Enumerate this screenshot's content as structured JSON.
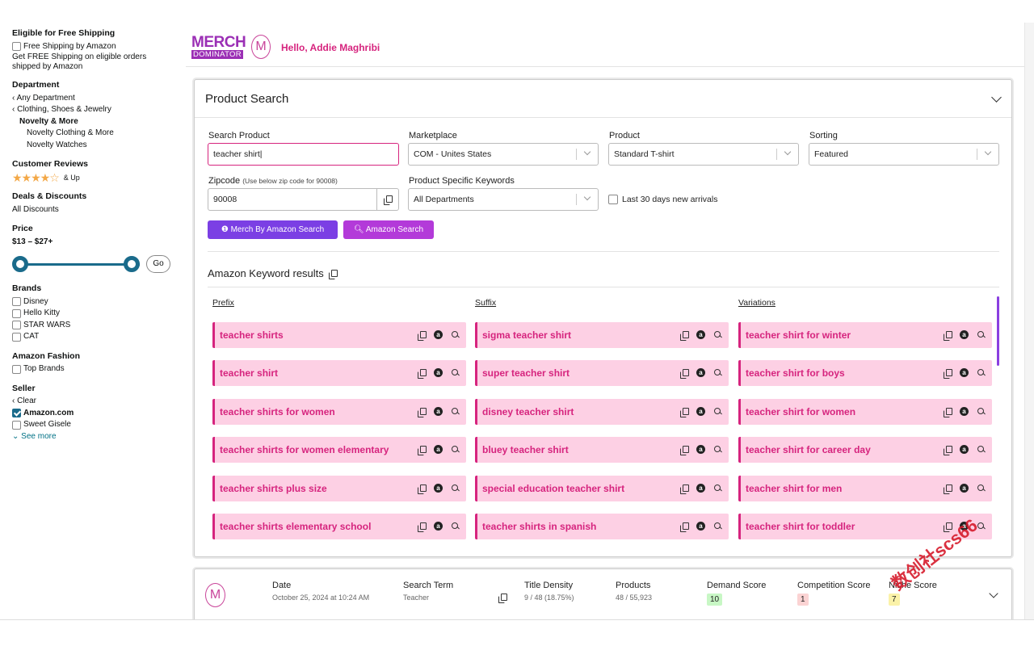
{
  "sidebar": {
    "shipping": {
      "heading": "Eligible for Free Shipping",
      "option": "Free Shipping by Amazon",
      "note": "Get FREE Shipping on eligible orders shipped by Amazon"
    },
    "department": {
      "heading": "Department",
      "items": [
        "Any Department",
        "Clothing, Shoes & Jewelry",
        "Novelty & More",
        "Novelty Clothing & More",
        "Novelty Watches"
      ]
    },
    "reviews": {
      "heading": "Customer Reviews",
      "stars": "★★★★☆",
      "suffix": "& Up",
      "rating_value": 4
    },
    "deals": {
      "heading": "Deals & Discounts",
      "item": "All Discounts"
    },
    "price": {
      "heading": "Price",
      "range": "$13 – $27+",
      "go_label": "Go"
    },
    "brands": {
      "heading": "Brands",
      "items": [
        "Disney",
        "Hello Kitty",
        "STAR WARS",
        "CAT"
      ]
    },
    "fashion": {
      "heading": "Amazon Fashion",
      "item": "Top Brands"
    },
    "seller": {
      "heading": "Seller",
      "clear": "Clear",
      "items": [
        "Amazon.com",
        "Sweet Gisele"
      ],
      "see_more": "See more"
    }
  },
  "header": {
    "logo_top": "MERCH",
    "logo_bottom": "DOMINATOR",
    "logo_badge": "M",
    "greeting": "Hello, Addie Maghribi"
  },
  "search": {
    "title": "Product Search",
    "product_label": "Search Product",
    "product_value": "teacher shirt",
    "marketplace_label": "Marketplace",
    "marketplace_value": "COM - Unites States",
    "product_type_label": "Product",
    "product_type_value": "Standard T-shirt",
    "sorting_label": "Sorting",
    "sorting_value": "Featured",
    "zipcode_label": "Zipcode",
    "zipcode_hint": "(Use below zip code for 90008)",
    "zipcode_value": "90008",
    "psk_label": "Product Specific Keywords",
    "psk_value": "All Departments",
    "new_arrivals_label": "Last 30 days new arrivals",
    "mba_button": "Merch By Amazon Search",
    "amazon_button": "Amazon Search"
  },
  "keywords": {
    "title": "Amazon Keyword results",
    "prefix_heading": "Prefix",
    "suffix_heading": "Suffix",
    "variations_heading": "Variations",
    "prefix": [
      "teacher shirts",
      "teacher shirt",
      "teacher shirts for women",
      "teacher shirts for women elementary",
      "teacher shirts plus size",
      "teacher shirts elementary school"
    ],
    "suffix": [
      "sigma teacher shirt",
      "super teacher shirt",
      "disney teacher shirt",
      "bluey teacher shirt",
      "special education teacher shirt",
      "teacher shirts in spanish"
    ],
    "variations": [
      "teacher shirt for winter",
      "teacher shirt for boys",
      "teacher shirt for women",
      "teacher shirt for career day",
      "teacher shirt for men",
      "teacher shirt for toddler"
    ]
  },
  "history": {
    "logo": "M",
    "date_label": "Date",
    "date_value": "October 25, 2024 at 10:24 AM",
    "term_label": "Search Term",
    "term_value": "Teacher",
    "density_label": "Title Density",
    "density_value": "9 / 48 (18.75%)",
    "products_label": "Products",
    "products_value": "48 / 55,923",
    "demand_label": "Demand Score",
    "demand_value": "10",
    "competition_label": "Competition Score",
    "competition_value": "1",
    "niche_label": "Niche Score",
    "niche_value": "7"
  },
  "watermark": "数创社scs66",
  "colors": {
    "accent": "#d6247e",
    "purple": "#7b3fe4",
    "teal": "#1a6b8b",
    "chip": "#fdd0e4"
  }
}
